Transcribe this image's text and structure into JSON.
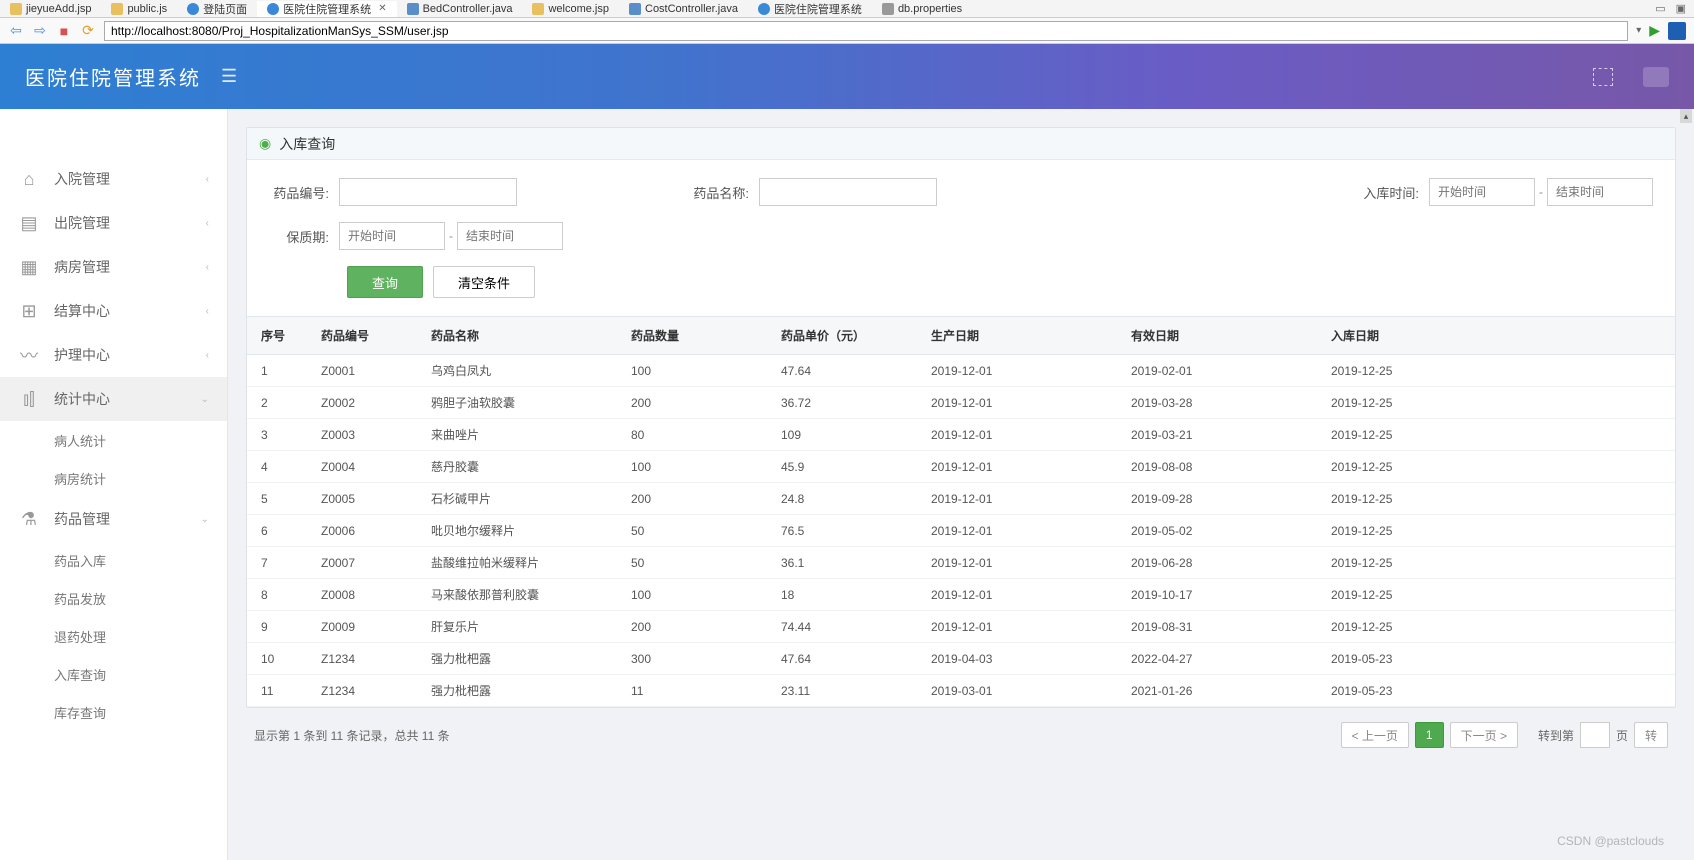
{
  "ide": {
    "tabs": [
      {
        "label": "jieyueAdd.jsp",
        "type": "jsp"
      },
      {
        "label": "public.js",
        "type": "jsp"
      },
      {
        "label": "登陆页面",
        "type": "web"
      },
      {
        "label": "医院住院管理系统",
        "type": "web",
        "active": true,
        "closable": true
      },
      {
        "label": "BedController.java",
        "type": "java"
      },
      {
        "label": "welcome.jsp",
        "type": "jsp"
      },
      {
        "label": "CostController.java",
        "type": "java"
      },
      {
        "label": "医院住院管理系统",
        "type": "web"
      },
      {
        "label": "db.properties",
        "type": "prop"
      }
    ],
    "url": "http://localhost:8080/Proj_HospitalizationManSys_SSM/user.jsp"
  },
  "header": {
    "title": "医院住院管理系统"
  },
  "sidebar": {
    "items": [
      {
        "icon": "home",
        "label": "入院管理",
        "chev": "‹"
      },
      {
        "icon": "discharge",
        "label": "出院管理",
        "chev": "‹"
      },
      {
        "icon": "building",
        "label": "病房管理",
        "chev": "‹"
      },
      {
        "icon": "map",
        "label": "结算中心",
        "chev": "‹"
      },
      {
        "icon": "pulse",
        "label": "护理中心",
        "chev": "‹"
      },
      {
        "icon": "chart",
        "label": "统计中心",
        "chev": "⌄",
        "expanded": true,
        "subs": [
          {
            "label": "病人统计"
          },
          {
            "label": "病房统计"
          }
        ]
      },
      {
        "icon": "flask",
        "label": "药品管理",
        "chev": "⌄",
        "expanded": true,
        "subs": [
          {
            "label": "药品入库"
          },
          {
            "label": "药品发放"
          },
          {
            "label": "退药处理"
          },
          {
            "label": "入库查询"
          },
          {
            "label": "库存查询"
          }
        ]
      }
    ]
  },
  "panel": {
    "title": "入库查询"
  },
  "search": {
    "drug_code_label": "药品编号:",
    "drug_name_label": "药品名称:",
    "stock_time_label": "入库时间:",
    "shelf_life_label": "保质期:",
    "start_ph": "开始时间",
    "end_ph": "结束时间",
    "query_btn": "查询",
    "clear_btn": "清空条件"
  },
  "table": {
    "columns": [
      "序号",
      "药品编号",
      "药品名称",
      "药品数量",
      "药品单价（元）",
      "生产日期",
      "有效日期",
      "入库日期"
    ],
    "rows": [
      [
        "1",
        "Z0001",
        "乌鸡白凤丸",
        "100",
        "47.64",
        "2019-12-01",
        "2019-02-01",
        "2019-12-25"
      ],
      [
        "2",
        "Z0002",
        "鸦胆子油软胶囊",
        "200",
        "36.72",
        "2019-12-01",
        "2019-03-28",
        "2019-12-25"
      ],
      [
        "3",
        "Z0003",
        "来曲唑片",
        "80",
        "109",
        "2019-12-01",
        "2019-03-21",
        "2019-12-25"
      ],
      [
        "4",
        "Z0004",
        "慈丹胶囊",
        "100",
        "45.9",
        "2019-12-01",
        "2019-08-08",
        "2019-12-25"
      ],
      [
        "5",
        "Z0005",
        "石杉碱甲片",
        "200",
        "24.8",
        "2019-12-01",
        "2019-09-28",
        "2019-12-25"
      ],
      [
        "6",
        "Z0006",
        "吡贝地尔缓释片",
        "50",
        "76.5",
        "2019-12-01",
        "2019-05-02",
        "2019-12-25"
      ],
      [
        "7",
        "Z0007",
        "盐酸维拉帕米缓释片",
        "50",
        "36.1",
        "2019-12-01",
        "2019-06-28",
        "2019-12-25"
      ],
      [
        "8",
        "Z0008",
        "马来酸依那普利胶囊",
        "100",
        "18",
        "2019-12-01",
        "2019-10-17",
        "2019-12-25"
      ],
      [
        "9",
        "Z0009",
        "肝复乐片",
        "200",
        "74.44",
        "2019-12-01",
        "2019-08-31",
        "2019-12-25"
      ],
      [
        "10",
        "Z1234",
        "强力枇杷露",
        "300",
        "47.64",
        "2019-04-03",
        "2022-04-27",
        "2019-05-23"
      ],
      [
        "11",
        "Z1234",
        "强力枇杷露",
        "11",
        "23.11",
        "2019-03-01",
        "2021-01-26",
        "2019-05-23"
      ]
    ]
  },
  "pager": {
    "info": "显示第 1 条到 11 条记录，总共 11 条",
    "prev": "< 上一页",
    "page": "1",
    "next": "下一页 >",
    "goto_label": "转到第",
    "page_suffix": "页",
    "go_btn": "转"
  },
  "watermark": "CSDN @pastclouds"
}
